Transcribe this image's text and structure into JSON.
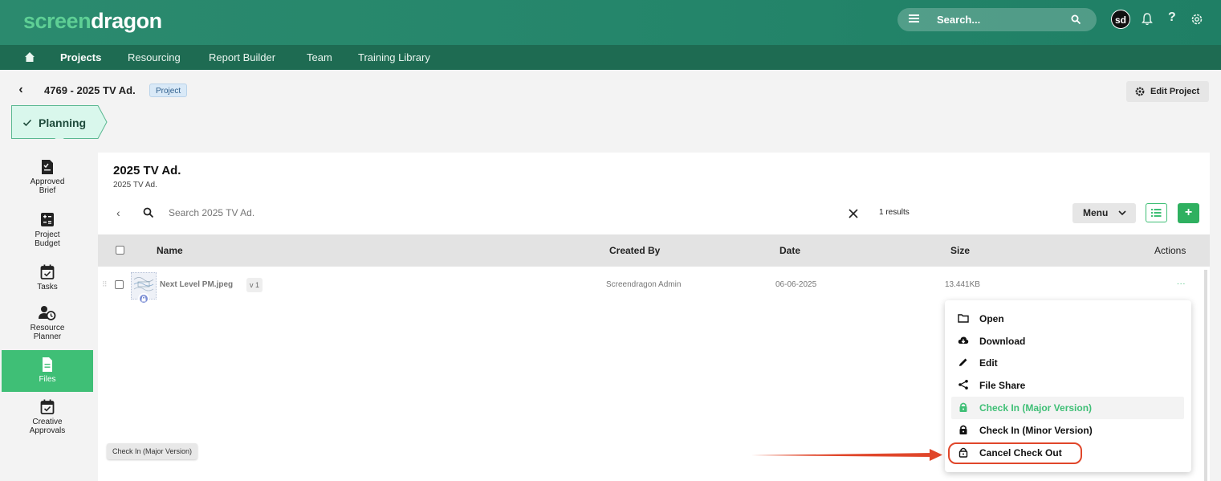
{
  "header": {
    "logo_part1": "screen",
    "logo_part2": "dragon",
    "search_placeholder": "Search...",
    "avatar_initials": "sd"
  },
  "nav": {
    "items": [
      {
        "label": "Projects",
        "active": true
      },
      {
        "label": "Resourcing"
      },
      {
        "label": "Report Builder"
      },
      {
        "label": "Team"
      },
      {
        "label": "Training Library"
      }
    ]
  },
  "project": {
    "title": "4769 - 2025 TV Ad.",
    "badge": "Project",
    "edit_button": "Edit Project",
    "stage": "Planning"
  },
  "rail": {
    "items": [
      {
        "label": "Approved Brief",
        "icon": "brief-doc-icon"
      },
      {
        "label": "Project Budget",
        "icon": "calculator-icon"
      },
      {
        "label": "Tasks",
        "icon": "calendar-check-icon"
      },
      {
        "label": "Resource Planner",
        "icon": "person-clock-icon"
      },
      {
        "label": "Files",
        "icon": "file-icon",
        "active": true
      },
      {
        "label": "Creative Approvals",
        "icon": "calendar-check-icon"
      }
    ]
  },
  "panel": {
    "title": "2025 TV Ad.",
    "subtitle": "2025 TV Ad.",
    "search_placeholder": "Search 2025 TV Ad.",
    "results": "1 results",
    "menu_button": "Menu"
  },
  "table": {
    "columns": {
      "name": "Name",
      "created_by": "Created By",
      "date": "Date",
      "size": "Size",
      "actions": "Actions"
    },
    "rows": [
      {
        "name": "Next Level PM.jpeg",
        "version": "v 1",
        "created_by": "Screendragon Admin",
        "date": "06-06-2025",
        "size": "13.441KB",
        "actions": "..."
      }
    ]
  },
  "dropdown": {
    "items": [
      {
        "label": "Open",
        "icon": "folder-icon"
      },
      {
        "label": "Download",
        "icon": "cloud-download-icon"
      },
      {
        "label": "Edit",
        "icon": "pencil-icon"
      },
      {
        "label": "File Share",
        "icon": "share-icon"
      },
      {
        "label": "Check In (Major Version)",
        "icon": "lock-icon",
        "highlighted": true
      },
      {
        "label": "Check In (Minor Version)",
        "icon": "lock-icon"
      },
      {
        "label": "Cancel Check Out",
        "icon": "unlock-icon"
      }
    ]
  },
  "tooltip": "Check In (Major Version)",
  "colors": {
    "brand_green": "#3fbf76",
    "header_green": "#25866b",
    "nav_green": "#1e6b52",
    "annotation_red": "#e0462a"
  }
}
